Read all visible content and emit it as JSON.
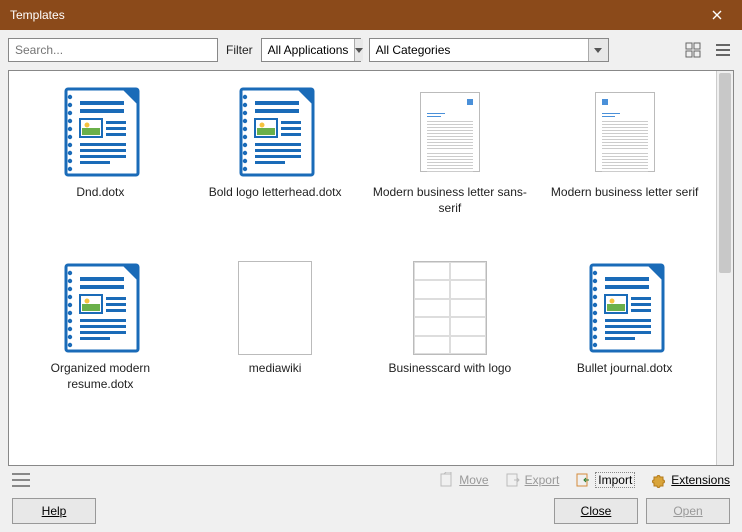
{
  "window": {
    "title": "Templates"
  },
  "toolbar": {
    "search_placeholder": "Search...",
    "filter_label": "Filter",
    "apps_selected": "All Applications",
    "categories_selected": "All Categories"
  },
  "templates": [
    {
      "label": "Dnd.dotx",
      "kind": "odt"
    },
    {
      "label": "Bold logo letterhead.dotx",
      "kind": "odt"
    },
    {
      "label": "Modern business letter sans-serif",
      "kind": "doc-right"
    },
    {
      "label": "Modern business letter serif",
      "kind": "doc-left"
    },
    {
      "label": "Organized modern resume.dotx",
      "kind": "odt"
    },
    {
      "label": "mediawiki",
      "kind": "blank"
    },
    {
      "label": "Businesscard with logo",
      "kind": "cards"
    },
    {
      "label": "Bullet journal.dotx",
      "kind": "odt"
    }
  ],
  "actions": {
    "move": "Move",
    "export": "Export",
    "import": "Import",
    "extensions": "Extensions"
  },
  "buttons": {
    "help": "Help",
    "close": "Close",
    "open": "Open"
  }
}
